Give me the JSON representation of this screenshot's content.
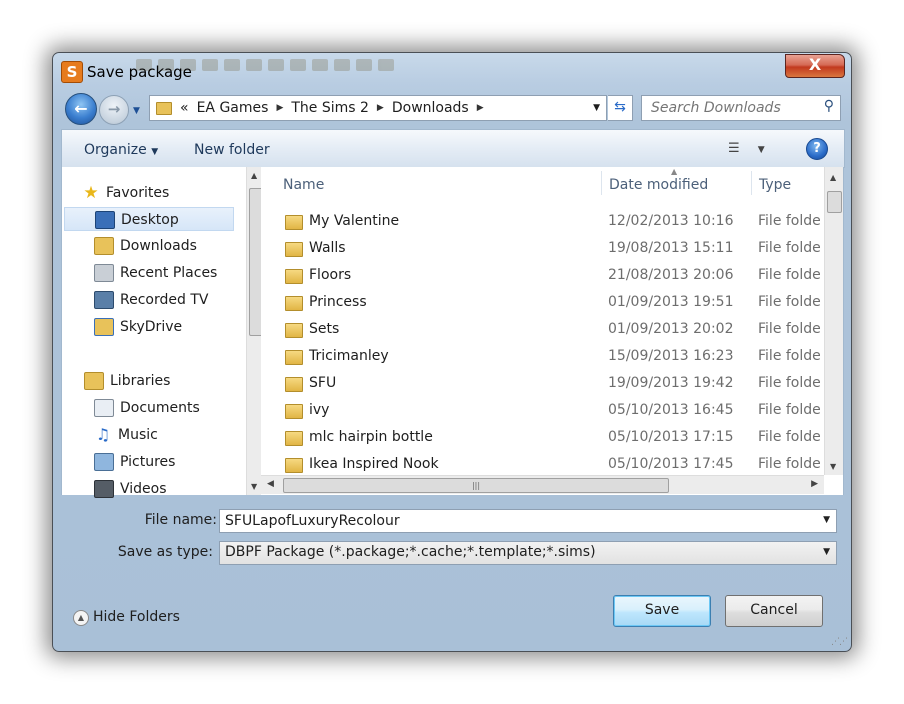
{
  "window": {
    "title": "Save package",
    "close_label": "X"
  },
  "navigation": {
    "back_label": "←",
    "forward_label": "→",
    "breadcrumb": [
      "EA Games",
      "The Sims 2",
      "Downloads"
    ],
    "overflow_label": "«",
    "search_placeholder": "Search Downloads"
  },
  "toolbar": {
    "organize_label": "Organize",
    "new_folder_label": "New folder",
    "help_label": "?"
  },
  "nav_pane": {
    "favorites": {
      "label": "Favorites",
      "items": [
        {
          "label": "Desktop",
          "selected": true
        },
        {
          "label": "Downloads"
        },
        {
          "label": "Recent Places"
        },
        {
          "label": "Recorded TV"
        },
        {
          "label": "SkyDrive"
        }
      ]
    },
    "libraries": {
      "label": "Libraries",
      "items": [
        {
          "label": "Documents"
        },
        {
          "label": "Music"
        },
        {
          "label": "Pictures"
        },
        {
          "label": "Videos"
        }
      ]
    }
  },
  "file_list": {
    "columns": {
      "name": "Name",
      "date": "Date modified",
      "type": "Type"
    },
    "rows": [
      {
        "name": "My Valentine",
        "date": "12/02/2013 10:16",
        "type": "File folder"
      },
      {
        "name": "Walls",
        "date": "19/08/2013 15:11",
        "type": "File folder"
      },
      {
        "name": "Floors",
        "date": "21/08/2013 20:06",
        "type": "File folder"
      },
      {
        "name": "Princess",
        "date": "01/09/2013 19:51",
        "type": "File folder"
      },
      {
        "name": "Sets",
        "date": "01/09/2013 20:02",
        "type": "File folder"
      },
      {
        "name": "Tricimanley",
        "date": "15/09/2013 16:23",
        "type": "File folder"
      },
      {
        "name": "SFU",
        "date": "19/09/2013 19:42",
        "type": "File folder"
      },
      {
        "name": "ivy",
        "date": "05/10/2013 16:45",
        "type": "File folder"
      },
      {
        "name": "mlc hairpin bottle",
        "date": "05/10/2013 17:15",
        "type": "File folder"
      },
      {
        "name": "Ikea Inspired Nook",
        "date": "05/10/2013 17:45",
        "type": "File folder"
      }
    ]
  },
  "form": {
    "file_name_label": "File name:",
    "file_name_value": "SFULapofLuxuryRecolour",
    "save_type_label": "Save as type:",
    "save_type_value": "DBPF Package (*.package;*.cache;*.template;*.sims)"
  },
  "footer": {
    "hide_folders_label": "Hide Folders",
    "save_label": "Save",
    "cancel_label": "Cancel"
  },
  "colors": {
    "title_bar": "#b9cde2",
    "close": "#c2391f",
    "accent": "#2a6bc8",
    "folder": "#e1b545"
  }
}
